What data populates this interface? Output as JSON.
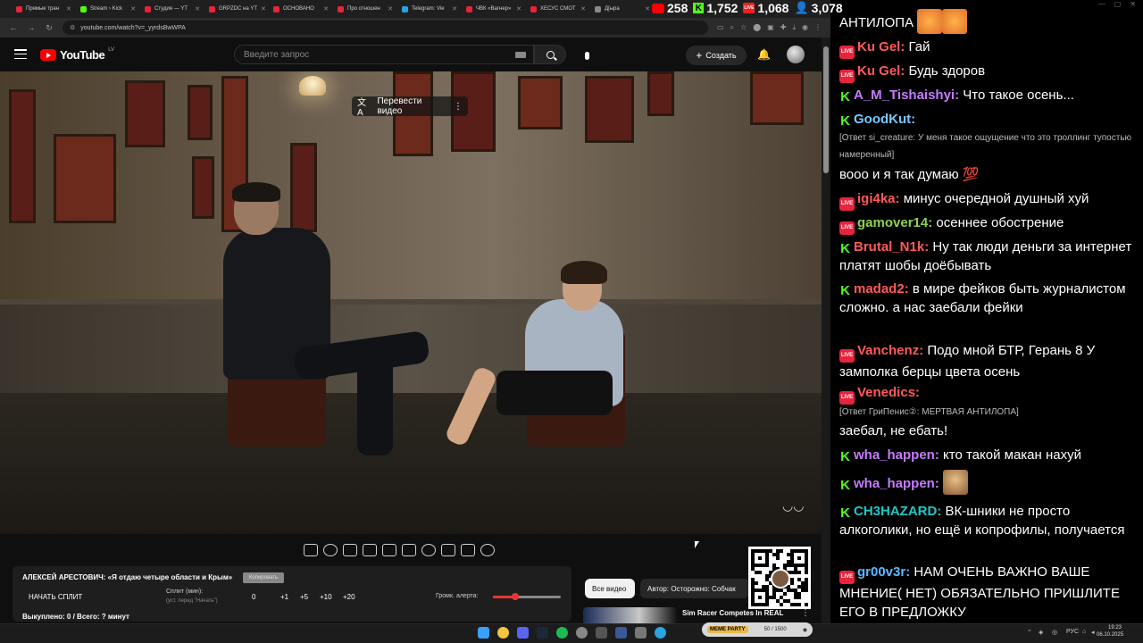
{
  "browser": {
    "tabs": [
      {
        "label": "Прямые тран",
        "color": "#e8233c"
      },
      {
        "label": "Stream › Kick",
        "color": "#53fc18"
      },
      {
        "label": "Студия — YT",
        "color": "#e8233c"
      },
      {
        "label": "GRPZDC на YT",
        "color": "#e8233c"
      },
      {
        "label": "ОСНОВАНО",
        "color": "#e8233c"
      },
      {
        "label": "Про отношен",
        "color": "#e8233c"
      },
      {
        "label": "Telegram: Vie",
        "color": "#2aa3e0"
      },
      {
        "label": "ЧВК «Вагнер»",
        "color": "#e8233c"
      },
      {
        "label": "ХЕСУС СМОТ",
        "color": "#e8233c"
      },
      {
        "label": "Д[ыра",
        "color": "#888888"
      }
    ],
    "url": "youtube.com/watch?v=_yyrdsBwWPA"
  },
  "youtube": {
    "logo_text": "YouTube",
    "country_code": "LV",
    "search_placeholder": "Введите запрос",
    "create_label": "Создать",
    "video": {
      "translate_label": "Перевести видео"
    },
    "split_panel": {
      "title": "АЛЕКСЕЙ АРЕСТОВИЧ: «Я отдаю четыре области и Крым»",
      "badge": "Копировать",
      "start_label": "НАЧАТЬ СПЛИТ",
      "split_label": "Сплит (мин):",
      "split_hint": "(уст. перед \"Начать\")",
      "split_value": "0",
      "steps": [
        "+1",
        "+5",
        "+10",
        "+20"
      ],
      "volume_label": "Громк. алерта:",
      "volume_level": 0.33,
      "footer": "Выкуплено: 0 / Всего: ? минут"
    },
    "chips": {
      "all": "Все видео",
      "author": "Автор: Осторожно: Собчак"
    },
    "recommendation": {
      "title": "Sim Racer Competes In REAL"
    }
  },
  "stream_stats": {
    "youtube_viewers": "258",
    "kick_viewers": "1,752",
    "vk_viewers": "1,068",
    "total_viewers": "3,078"
  },
  "chat": {
    "top_fragment": "АНТИЛОПА",
    "messages": [
      {
        "platform": "live",
        "nick": "Ku Gel:",
        "color": "#ff5a5a",
        "text": "Гай"
      },
      {
        "platform": "live",
        "nick": "Ku Gel:",
        "color": "#ff5a5a",
        "text": "Будь здоров"
      },
      {
        "platform": "kick",
        "nick": "A_M_Tishaishyi:",
        "color": "#c57cff",
        "text": "Что такое осень..."
      },
      {
        "platform": "kick",
        "nick": "GoodKut:",
        "color": "#7ac8ff",
        "text": ""
      },
      {
        "platform": "reply",
        "text": "[Ответ si_creature: У меня такое ощущение что это троллинг тупостью намеренный]"
      },
      {
        "platform": "plain",
        "text": "вооо и я так думаю 💯"
      },
      {
        "platform": "live",
        "nick": "igi4ka:",
        "color": "#ff5a5a",
        "text": "минус очередной душный хуй"
      },
      {
        "platform": "live",
        "nick": "gamover14:",
        "color": "#8fd14f",
        "text": "осеннее обострение"
      },
      {
        "platform": "kick",
        "nick": "Brutal_N1k:",
        "color": "#ff5a5a",
        "text": "Ну так люди деньги за интернет платят шобы доёбывать"
      },
      {
        "platform": "kick",
        "nick": "madad2:",
        "color": "#ff5a5a",
        "text": "в мире фейков быть журналистом сложно. а нас заебали фейки"
      },
      {
        "platform": "live",
        "nick": "Vanchenz:",
        "color": "#ff5a5a",
        "text": "Подо мной БТР, Герань 8 У замполка берцы цвета осень"
      },
      {
        "platform": "live",
        "nick": "Venedics:",
        "color": "#ff5a5a",
        "text": ""
      },
      {
        "platform": "reply",
        "text": "[Ответ ГриПенис②: МЕРТВАЯ АНТИЛОПА]"
      },
      {
        "platform": "plain",
        "text": "заебал, не ебать!"
      },
      {
        "platform": "kick",
        "nick": "wha_happen:",
        "color": "#c57cff",
        "text": "кто такой макан нахуй"
      },
      {
        "platform": "kick",
        "nick": "wha_happen:",
        "color": "#c57cff",
        "text": ""
      },
      {
        "platform": "kick",
        "nick": "CH3HAZARD:",
        "color": "#1ec8c8",
        "text": "ВК-шники не просто алкоголики, но ещё и копрофилы, получается"
      },
      {
        "platform": "live",
        "nick": "gr00v3r:",
        "color": "#5ab8ff",
        "text": "НАМ ОЧЕНЬ ВАЖНО ВАШЕ МНЕНИЕ( НЕТ) ОБЯЗАТЕЛЬНО ПРИШЛИТЕ ЕГО В ПРЕДЛОЖКУ"
      }
    ]
  },
  "taskbar": {
    "pill_label": "MEME PARTY",
    "pill_count": "50 / 1500",
    "lang": "РУС",
    "time": "19:23",
    "date": "06.10.2025"
  }
}
